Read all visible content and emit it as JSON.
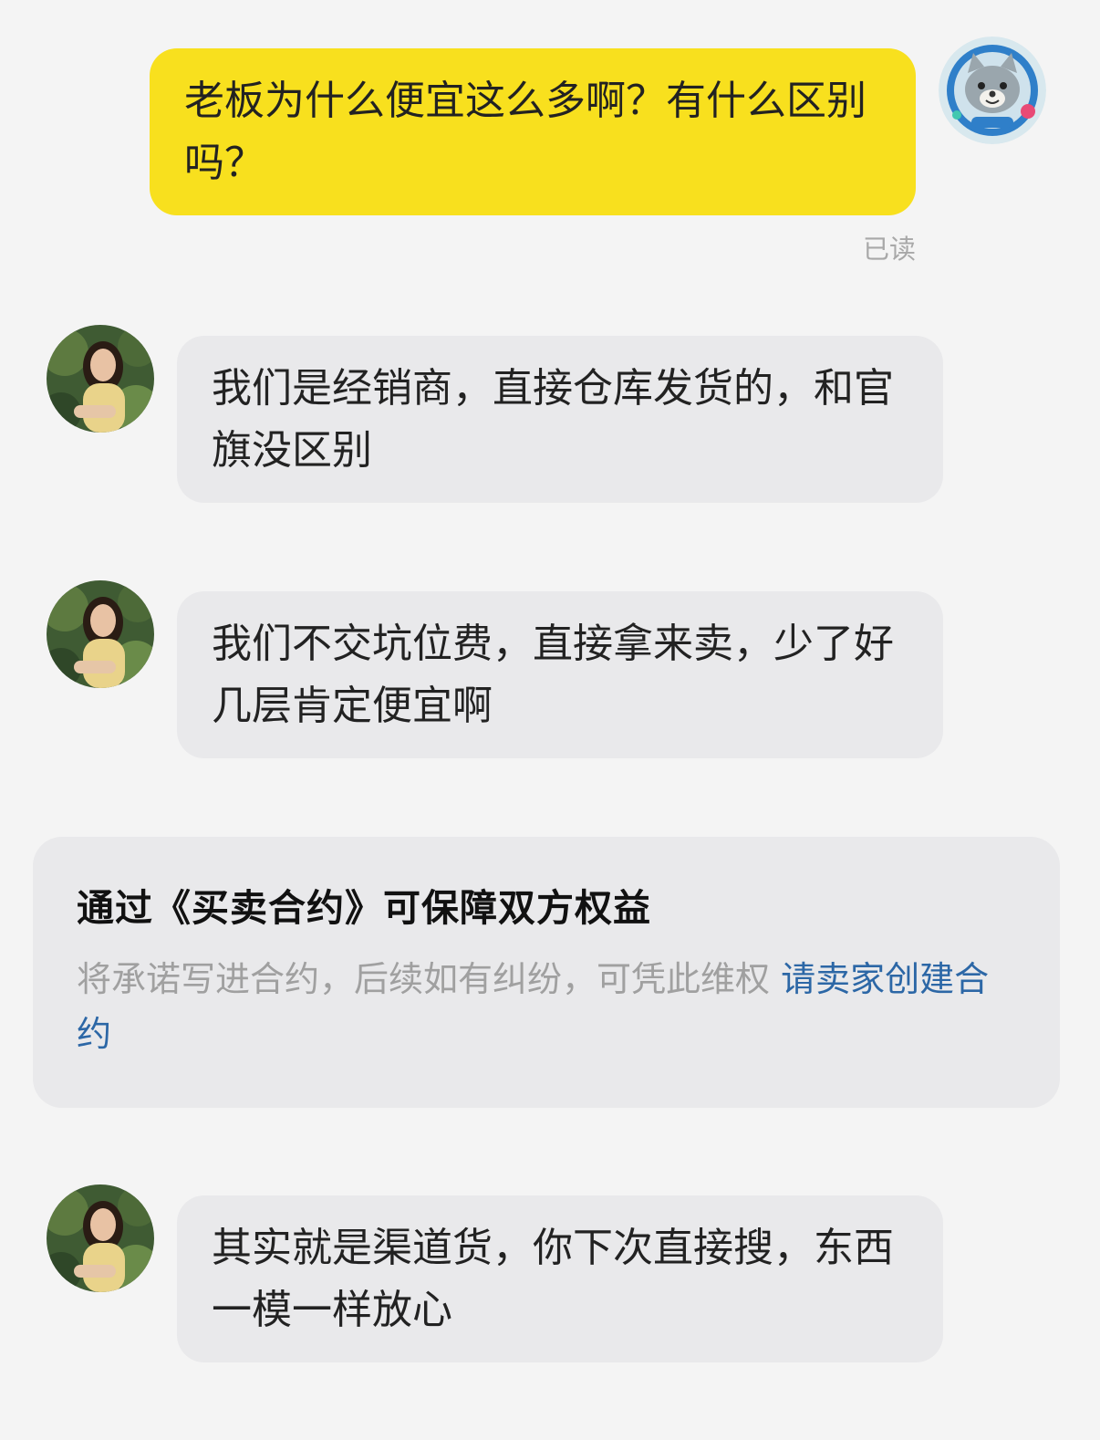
{
  "messages": [
    {
      "sender": "self",
      "text": "老板为什么便宜这么多啊？有什么区别吗？"
    },
    {
      "sender": "seller",
      "text": "我们是经销商，直接仓库发货的，和官旗没区别"
    },
    {
      "sender": "seller",
      "text": "我们不交坑位费，直接拿来卖，少了好几层肯定便宜啊"
    },
    {
      "sender": "seller",
      "text": "其实就是渠道货，你下次直接搜，东西一模一样放心"
    }
  ],
  "read_receipt": "已读",
  "contract_card": {
    "title": "通过《买卖合约》可保障双方权益",
    "description": "将承诺写进合约，后续如有纠纷，可凭此维权",
    "link_text": "请卖家创建合约"
  },
  "colors": {
    "self_bubble": "#f8e01e",
    "peer_bubble": "#e9e9eb",
    "background": "#f4f4f4",
    "link": "#2c67a6"
  },
  "icons": {
    "self_avatar": "cat-astronaut-avatar",
    "seller_avatar": "seller-photo-avatar"
  }
}
